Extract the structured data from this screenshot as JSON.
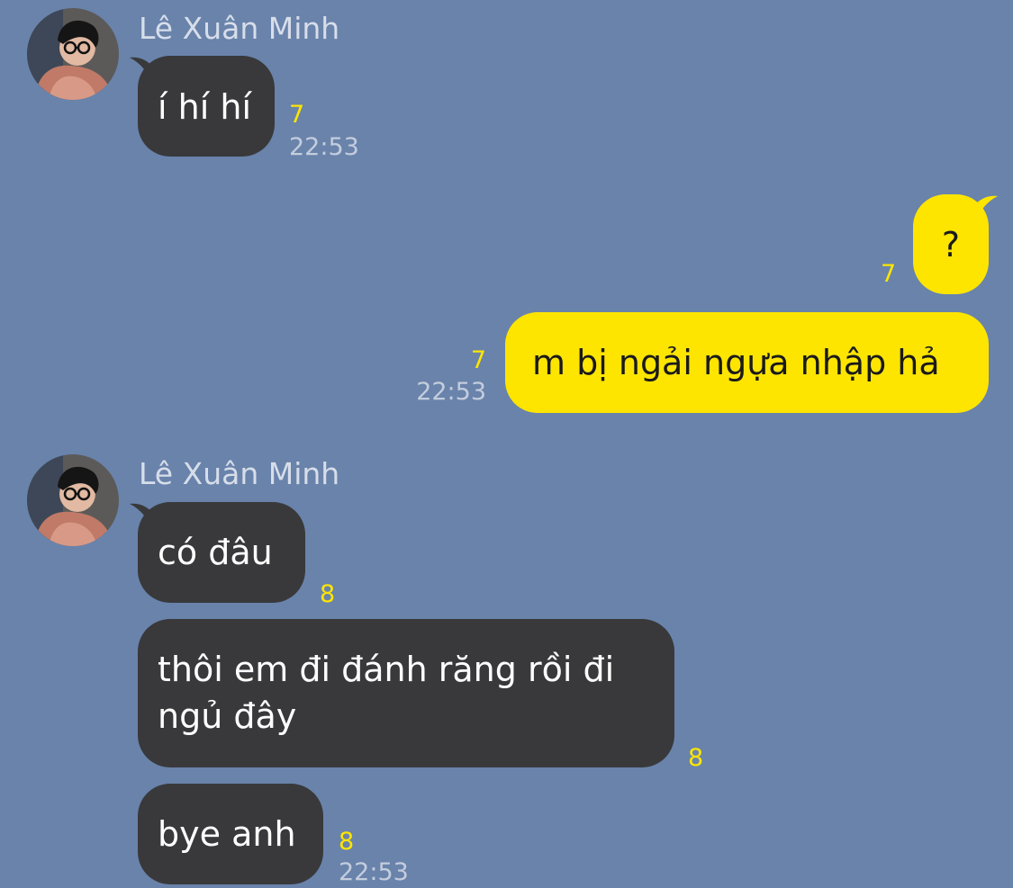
{
  "colors": {
    "background": "#6983ab",
    "incoming_bubble": "#39393b",
    "outgoing_bubble": "#fee500",
    "unread_count": "#fee500"
  },
  "messages": [
    {
      "sender": "Lê Xuân Minh",
      "avatar": "avatar-photo",
      "direction": "incoming",
      "text": "í hí hí",
      "unread": "7",
      "time": "22:53"
    },
    {
      "direction": "outgoing",
      "text": "?",
      "unread": "7"
    },
    {
      "direction": "outgoing",
      "text": "m bị ngải ngựa nhập hả",
      "unread": "7",
      "time": "22:53"
    },
    {
      "sender": "Lê Xuân Minh",
      "avatar": "avatar-photo",
      "direction": "incoming",
      "text": "có đâu",
      "unread": "8"
    },
    {
      "direction": "incoming",
      "text": "thôi em đi đánh răng rồi đi\nngủ đây",
      "unread": "8"
    },
    {
      "direction": "incoming",
      "text": "bye anh",
      "unread": "8",
      "time": "22:53"
    }
  ]
}
